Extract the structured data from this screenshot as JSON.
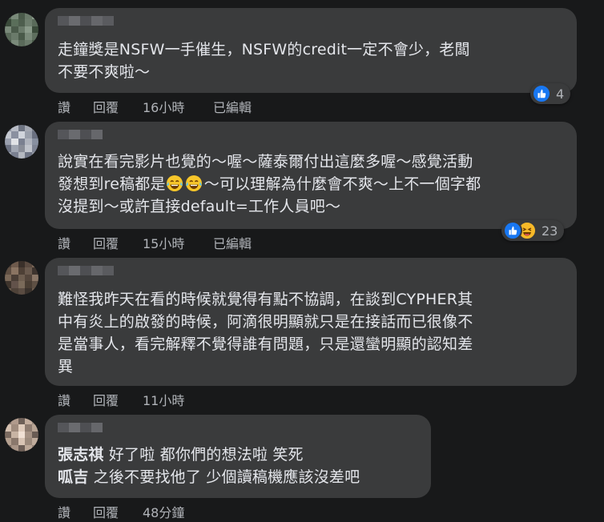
{
  "colors": {
    "bubble": "#3a3b3c",
    "background": "#18191a",
    "text": "#e4e6eb",
    "muted": "#b0b3b8",
    "like_blue": "#1877f2",
    "haha_yellow": "#f7b928"
  },
  "comments": [
    {
      "lines": [
        "走鐘獎是NSFW一手催生，NSFW的credit一定不會少，老闆",
        "不要不爽啦～"
      ],
      "actions": {
        "like": "讚",
        "reply": "回覆",
        "time": "16小時",
        "edited": "已編輯"
      },
      "reactions": {
        "icons": [
          "like-icon"
        ],
        "count": "4"
      }
    },
    {
      "lines": [
        "說實在看完影片也覺的～喔～薩泰爾付出這麼多喔～感覺活動",
        "發想到re稿都是",
        "～可以理解為什麼會不爽～上不一個字都",
        "沒提到～或許直接default=工作人員吧～"
      ],
      "actions": {
        "like": "讚",
        "reply": "回覆",
        "time": "15小時",
        "edited": "已編輯"
      },
      "reactions": {
        "icons": [
          "like-icon",
          "haha-icon"
        ],
        "count": "23"
      }
    },
    {
      "lines": [
        "難怪我昨天在看的時候就覺得有點不協調，在談到CYPHER其",
        "中有炎上的啟發的時候，阿滴很明顯就只是在接話而已很像不",
        "是當事人，看完解釋不覺得誰有問題，只是還蠻明顯的認知差",
        "異"
      ],
      "actions": {
        "like": "讚",
        "reply": "回覆",
        "time": "11小時",
        "edited": ""
      }
    },
    {
      "mentions": [
        {
          "name": "張志祺",
          "text": "好了啦 都你們的想法啦 笑死"
        },
        {
          "name": "呱吉",
          "text": "之後不要找他了 少個讀稿機應該沒差吧"
        }
      ],
      "actions": {
        "like": "讚",
        "reply": "回覆",
        "time": "48分鐘",
        "edited": ""
      }
    }
  ]
}
